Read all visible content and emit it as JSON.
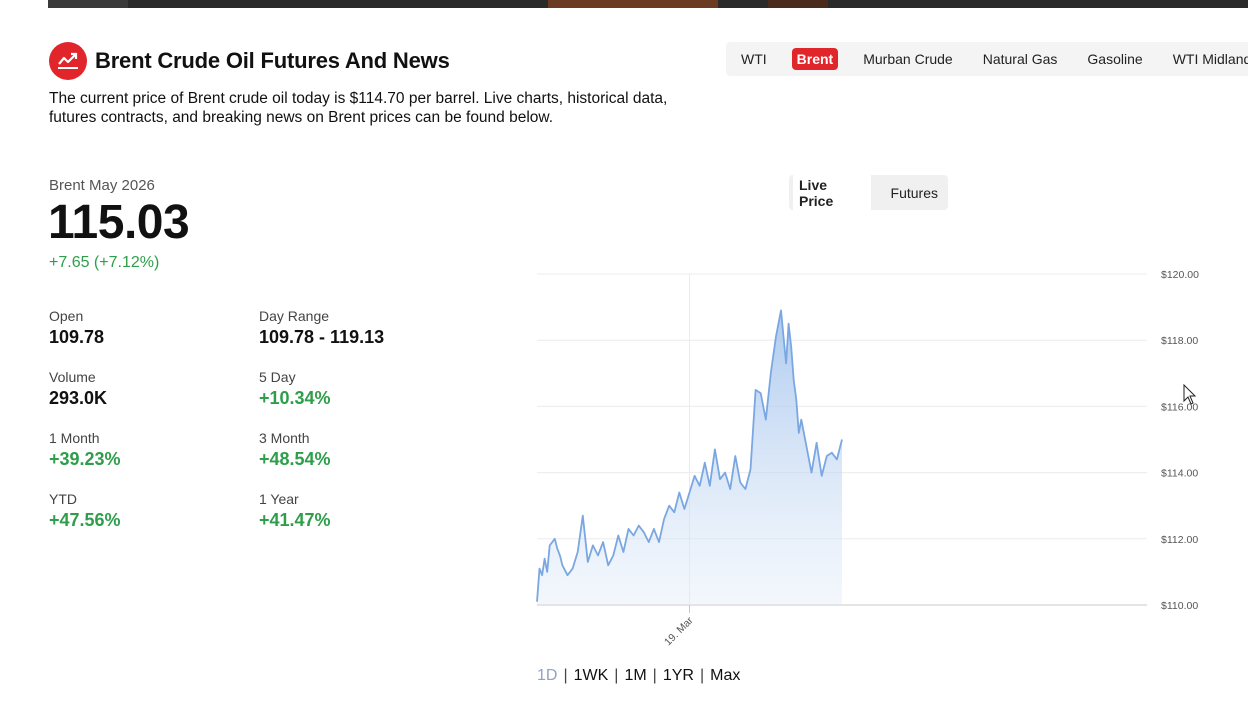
{
  "header": {
    "title": "Brent Crude Oil Futures And News",
    "logo_icon": "trending-chart-icon",
    "accent_color": "#e0262b"
  },
  "tabs": [
    {
      "label": "WTI",
      "active": false
    },
    {
      "label": "Brent",
      "active": true
    },
    {
      "label": "Murban Crude",
      "active": false
    },
    {
      "label": "Natural Gas",
      "active": false
    },
    {
      "label": "Gasoline",
      "active": false
    },
    {
      "label": "WTI Midland",
      "active": false
    }
  ],
  "intro": "The current price of Brent crude oil today is $114.70 per barrel. Live charts, historical data, futures contracts, and breaking news on Brent prices can be found below.",
  "quote": {
    "contract": "Brent May 2026",
    "price": "115.03",
    "change": "+7.65 (+7.12%)",
    "positive_color": "#2e9e4b"
  },
  "stats": [
    {
      "label": "Open",
      "value": "109.78",
      "positive": false
    },
    {
      "label": "Day Range",
      "value": "109.78 - 119.13",
      "positive": false
    },
    {
      "label": "Volume",
      "value": "293.0K",
      "positive": false
    },
    {
      "label": "5 Day",
      "value": "+10.34%",
      "positive": true
    },
    {
      "label": "1 Month",
      "value": "+39.23%",
      "positive": true
    },
    {
      "label": "3 Month",
      "value": "+48.54%",
      "positive": true
    },
    {
      "label": "YTD",
      "value": "+47.56%",
      "positive": true
    },
    {
      "label": "1 Year",
      "value": "+41.47%",
      "positive": true
    }
  ],
  "chart_toggle": {
    "live": "Live Price",
    "futures": "Futures",
    "active": "live"
  },
  "ranges": [
    {
      "label": "1D",
      "active": true
    },
    {
      "label": "1WK",
      "active": false
    },
    {
      "label": "1M",
      "active": false
    },
    {
      "label": "1YR",
      "active": false
    },
    {
      "label": "Max",
      "active": false
    }
  ],
  "chart_data": {
    "type": "area",
    "title": "",
    "xlabel": "",
    "ylabel": "",
    "ylim": [
      110,
      120
    ],
    "yticks": [
      110,
      112,
      114,
      116,
      118,
      120
    ],
    "ytick_labels": [
      "$110.00",
      "$112.00",
      "$114.00",
      "$116.00",
      "$118.00",
      "$120.00"
    ],
    "x_range_hours": [
      0,
      24
    ],
    "xticks": [
      {
        "label": "19. Mar",
        "hour": 6
      }
    ],
    "grid": true,
    "line_color": "#7aa7e2",
    "series": [
      {
        "name": "",
        "x_hours": [
          0.0,
          0.1,
          0.2,
          0.3,
          0.4,
          0.5,
          0.6,
          0.7,
          0.8,
          0.9,
          1.0,
          1.2,
          1.4,
          1.6,
          1.8,
          2.0,
          2.2,
          2.4,
          2.6,
          2.8,
          3.0,
          3.2,
          3.4,
          3.6,
          3.8,
          4.0,
          4.2,
          4.4,
          4.6,
          4.8,
          5.0,
          5.2,
          5.4,
          5.6,
          5.8,
          6.0,
          6.2,
          6.4,
          6.6,
          6.8,
          7.0,
          7.2,
          7.4,
          7.6,
          7.8,
          8.0,
          8.2,
          8.4,
          8.6,
          8.8,
          9.0,
          9.2,
          9.4,
          9.6,
          9.8,
          9.9,
          10.0,
          10.1,
          10.2,
          10.3,
          10.4,
          10.6,
          10.8,
          11.0,
          11.2,
          11.4,
          11.6,
          11.8,
          12.0
        ],
        "values": [
          110.1,
          111.1,
          110.9,
          111.4,
          111.0,
          111.8,
          111.9,
          112.0,
          111.7,
          111.5,
          111.2,
          110.9,
          111.1,
          111.6,
          112.7,
          111.3,
          111.8,
          111.5,
          111.9,
          111.2,
          111.5,
          112.1,
          111.6,
          112.3,
          112.1,
          112.4,
          112.2,
          111.9,
          112.3,
          111.9,
          112.6,
          113.0,
          112.8,
          113.4,
          112.9,
          113.4,
          113.9,
          113.6,
          114.3,
          113.6,
          114.7,
          113.8,
          114.0,
          113.5,
          114.5,
          113.7,
          113.5,
          114.1,
          116.5,
          116.4,
          115.6,
          117.0,
          118.1,
          118.9,
          117.3,
          118.5,
          117.8,
          116.8,
          116.2,
          115.2,
          115.6,
          114.8,
          114.0,
          114.9,
          113.9,
          114.5,
          114.6,
          114.4,
          115.0
        ]
      }
    ]
  }
}
